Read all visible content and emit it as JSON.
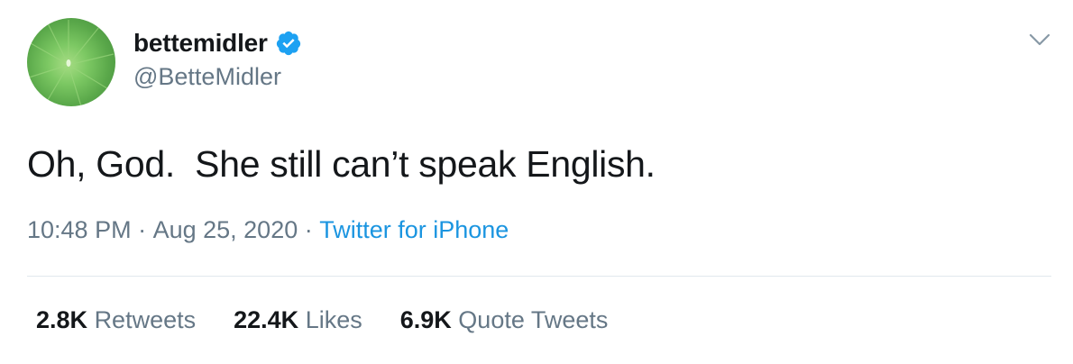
{
  "user": {
    "display_name": "bettemidler",
    "handle": "@BetteMidler",
    "verified": true,
    "avatar_icon": "lily-pad-avatar"
  },
  "tweet": {
    "text": "Oh, God.  She still can’t speak English.",
    "time": "10:48 PM",
    "separator1": " · ",
    "date": "Aug 25, 2020",
    "separator2": " · ",
    "source": "Twitter for iPhone"
  },
  "stats": {
    "retweets_count": "2.8K",
    "retweets_label": "Retweets",
    "likes_count": "22.4K",
    "likes_label": "Likes",
    "quotes_count": "6.9K",
    "quotes_label": "Quote Tweets"
  },
  "colors": {
    "verified": "#1da1f2",
    "link": "#1b95e0",
    "muted": "#657786",
    "text": "#14171a",
    "divider": "#e1e8ed"
  },
  "icons": {
    "verified": "verified-badge-icon",
    "menu": "chevron-down-icon"
  }
}
